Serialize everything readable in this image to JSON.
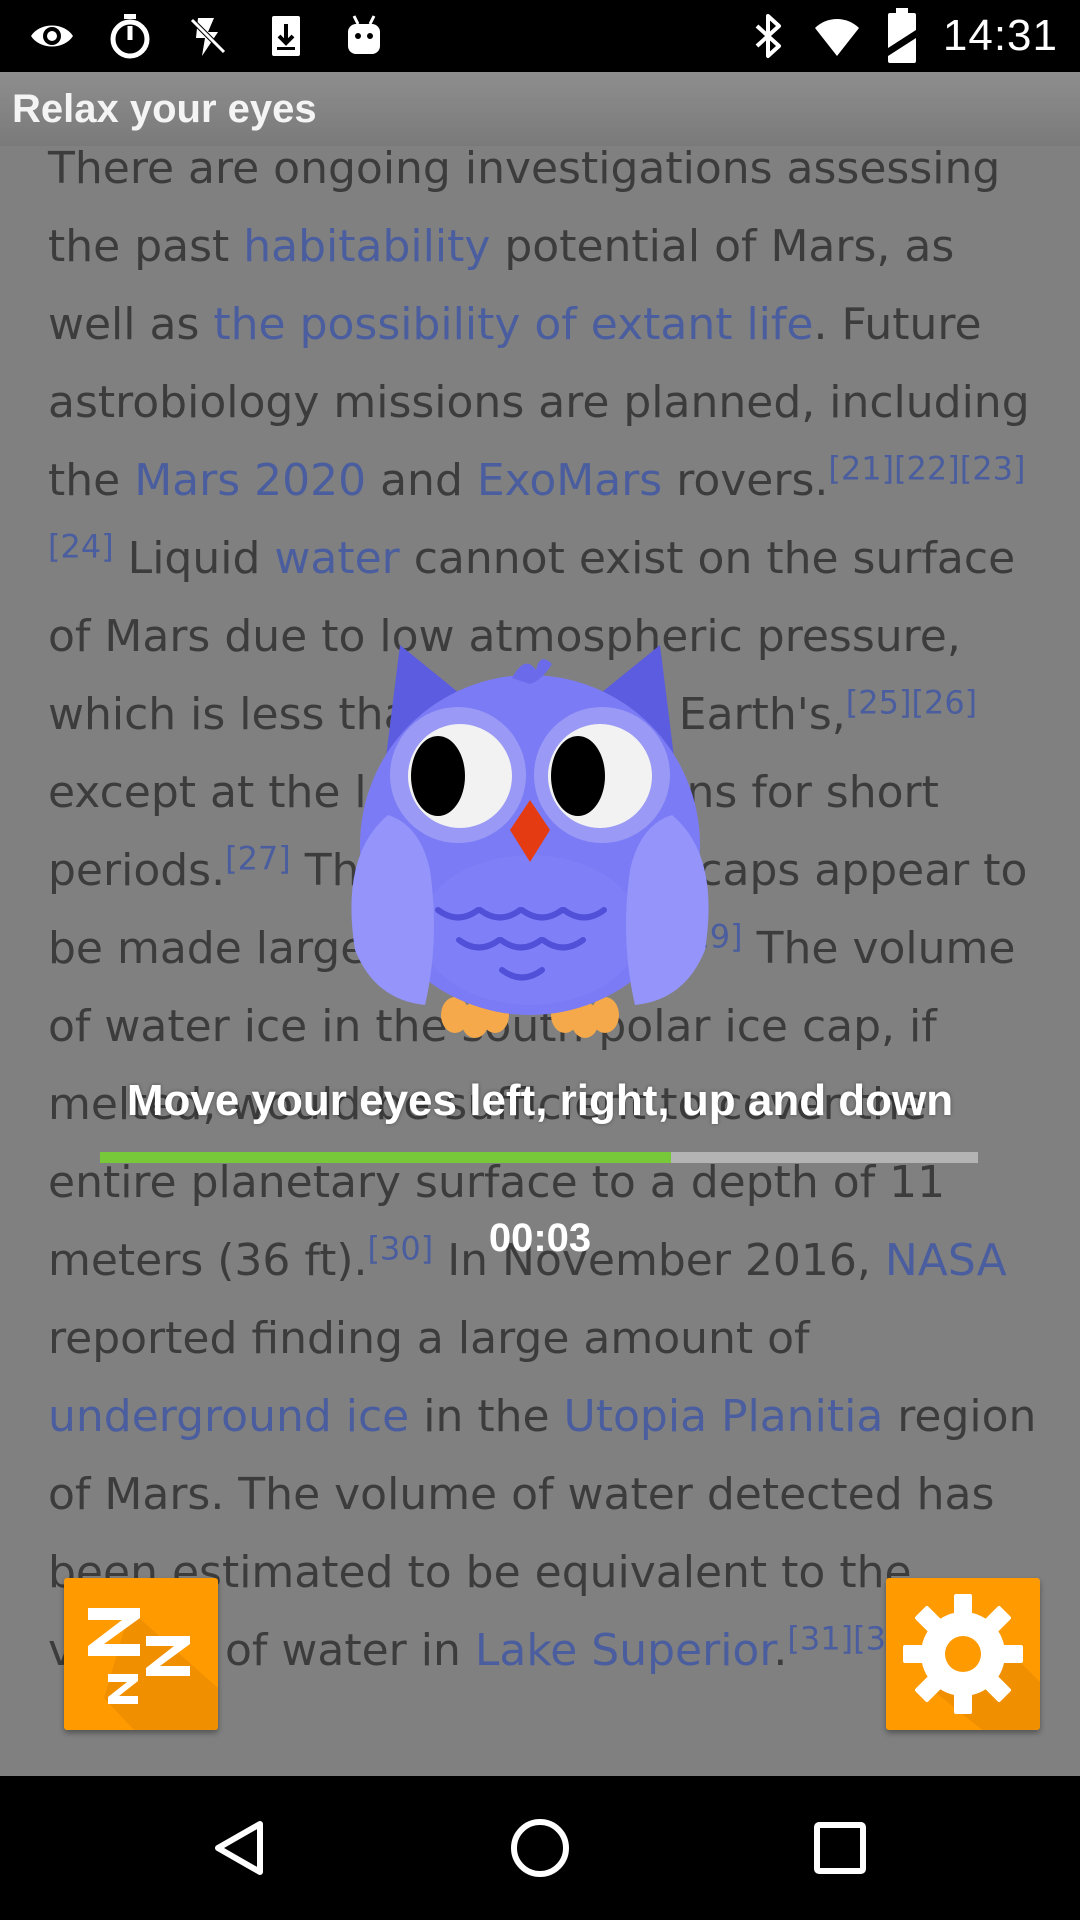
{
  "status_bar": {
    "time": "14:31",
    "left_icons": [
      "eye-icon",
      "timer-icon",
      "flash-off-icon",
      "download-icon",
      "android-icon"
    ],
    "right_icons": [
      "bluetooth-icon",
      "wifi-icon",
      "battery-icon"
    ]
  },
  "app_bar": {
    "title": "Relax your eyes"
  },
  "article": {
    "segments": [
      {
        "t": "There are ongoing investigations assessing the past "
      },
      {
        "t": "habitability",
        "k": "link"
      },
      {
        "t": " potential of Mars, as well as "
      },
      {
        "t": "the possibility of extant life",
        "k": "link"
      },
      {
        "t": ". Future astrobiology missions are planned, including the "
      },
      {
        "t": "Mars 2020",
        "k": "link"
      },
      {
        "t": " and "
      },
      {
        "t": "ExoMars",
        "k": "link"
      },
      {
        "t": " rovers."
      },
      {
        "t": "[21][22][23][24]",
        "k": "ref"
      },
      {
        "t": " Liquid "
      },
      {
        "t": "water",
        "k": "link"
      },
      {
        "t": " cannot exist on the surface of Mars due to low atmospheric pressure, which is less than 1% of the Earth's,"
      },
      {
        "t": "[25][26]",
        "k": "ref"
      },
      {
        "t": " except at the lowest elevations for short periods."
      },
      {
        "t": "[27]",
        "k": "ref"
      },
      {
        "t": " The two polar ice caps appear to be made largely of water."
      },
      {
        "t": "[28][29]",
        "k": "ref"
      },
      {
        "t": " The volume of water ice in the south polar ice cap, if melted, would be sufficient to cover the entire planetary surface to a depth of 11 meters (36 ft)."
      },
      {
        "t": "[30]",
        "k": "ref"
      },
      {
        "t": " In November 2016, "
      },
      {
        "t": "NASA",
        "k": "link"
      },
      {
        "t": " reported finding a large amount of "
      },
      {
        "t": "underground ice",
        "k": "link"
      },
      {
        "t": " in the "
      },
      {
        "t": "Utopia Planitia",
        "k": "link"
      },
      {
        "t": " region of Mars. The volume of water detected has been estimated to be equivalent to the volume of water in "
      },
      {
        "t": "Lake Superior",
        "k": "link"
      },
      {
        "t": "."
      },
      {
        "t": "[31][32][33]",
        "k": "ref"
      }
    ]
  },
  "exercise": {
    "instruction": "Move your eyes left, right, up and down",
    "progress": 0.65,
    "timer": "00:03"
  },
  "buttons": {
    "sleep_icon": "zzz-icon",
    "settings_icon": "gear-icon"
  },
  "nav_bar": {
    "buttons": [
      "back-icon",
      "home-icon",
      "recents-icon"
    ]
  },
  "colors": {
    "accent_orange": "#ff9a00",
    "progress_green": "#77c93a",
    "owl_purple": "#7b7bf5",
    "link_blue": "#4a5d9e"
  }
}
